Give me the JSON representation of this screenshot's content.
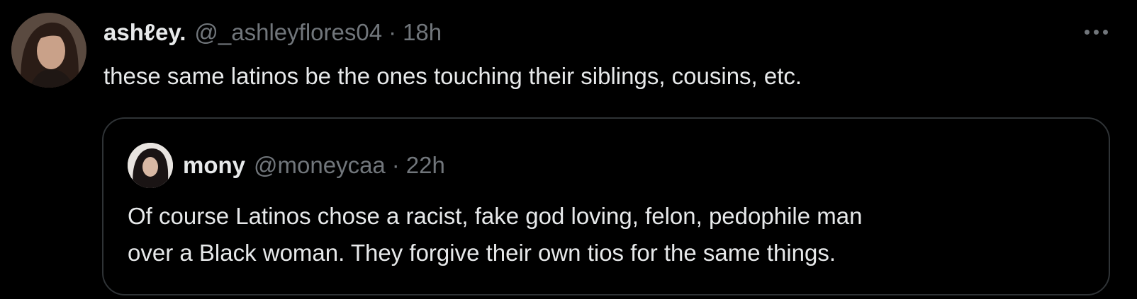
{
  "tweet": {
    "display_name": "ashℓey.",
    "handle": "@_ashleyflores04",
    "separator": "·",
    "time": "18h",
    "text": "these same latinos be the ones touching their siblings, cousins, etc.",
    "avatar_icon": "profile-photo",
    "more_icon": "more-horizontal-icon"
  },
  "quote": {
    "display_name": "mony",
    "handle": "@moneycaa",
    "separator": "·",
    "time": "22h",
    "text_lines": [
      "Of course Latinos chose a racist, fake god loving, felon, pedophile man",
      "over a Black woman. They forgive their own tios for the same things."
    ],
    "avatar_icon": "profile-photo"
  },
  "colors": {
    "background": "#000000",
    "primary_text": "#e7e9ea",
    "secondary_text": "#71767b",
    "border": "#2f3336"
  }
}
